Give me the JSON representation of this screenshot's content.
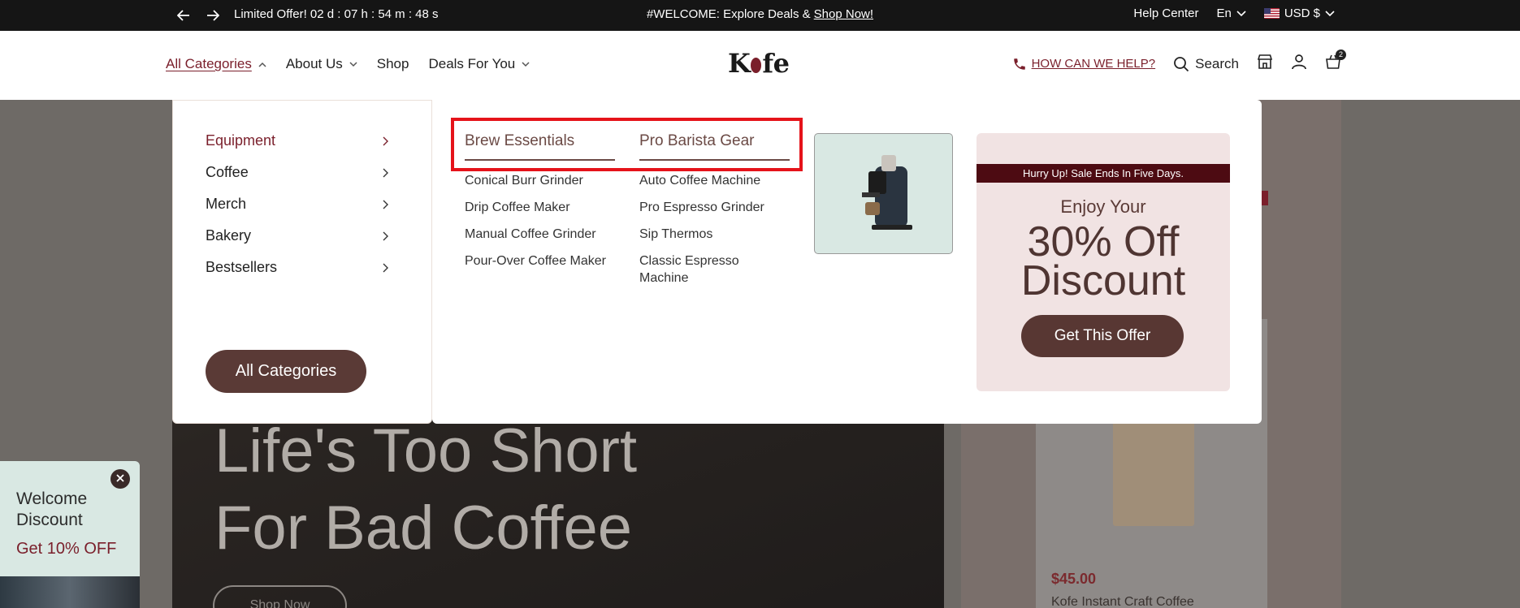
{
  "topbar": {
    "countdown": "Limited Offer! 02 d : 07 h : 54 m : 48 s",
    "welcome_text": "#WELCOME: Explore Deals &",
    "welcome_link": "Shop Now!",
    "help_center": "Help Center",
    "language": "En",
    "currency": "USD $"
  },
  "header": {
    "nav": [
      {
        "label": "All Categories"
      },
      {
        "label": "About Us"
      },
      {
        "label": "Shop"
      },
      {
        "label": "Deals For You"
      }
    ],
    "logo_left": "K",
    "logo_right": "fe",
    "help_link": "HOW CAN WE HELP?",
    "search_label": "Search",
    "cart_count": "2"
  },
  "categories": {
    "items": [
      "Equipment",
      "Coffee",
      "Merch",
      "Bakery",
      "Bestsellers"
    ],
    "button": "All Categories"
  },
  "mega": {
    "columns": [
      {
        "heading": "Brew Essentials",
        "links": [
          "Conical Burr Grinder",
          "Drip Coffee Maker",
          "Manual Coffee Grinder",
          "Pour-Over Coffee Maker"
        ]
      },
      {
        "heading": "Pro Barista Gear",
        "links": [
          "Auto Coffee Machine",
          "Pro Espresso Grinder",
          "Sip Thermos",
          "Classic Espresso Machine"
        ]
      }
    ],
    "offer": {
      "strip": "Hurry Up! Sale Ends In Five Days.",
      "enjoy": "Enjoy Your",
      "line1": "30% Off",
      "line2": "Discount",
      "button": "Get This Offer"
    }
  },
  "hero": {
    "headline_1": "Life's Too Short",
    "headline_2": "For Bad Coffee",
    "shop_now": "Shop Now",
    "price": "$45.00",
    "product_title": "Kofe Instant Craft Coffee"
  },
  "welcome_popup": {
    "title": "Welcome Discount",
    "subtitle": "Get 10% OFF"
  },
  "colors": {
    "accent": "#7a1f2b",
    "button": "#5a3a36",
    "highlight": "#e5131a"
  }
}
